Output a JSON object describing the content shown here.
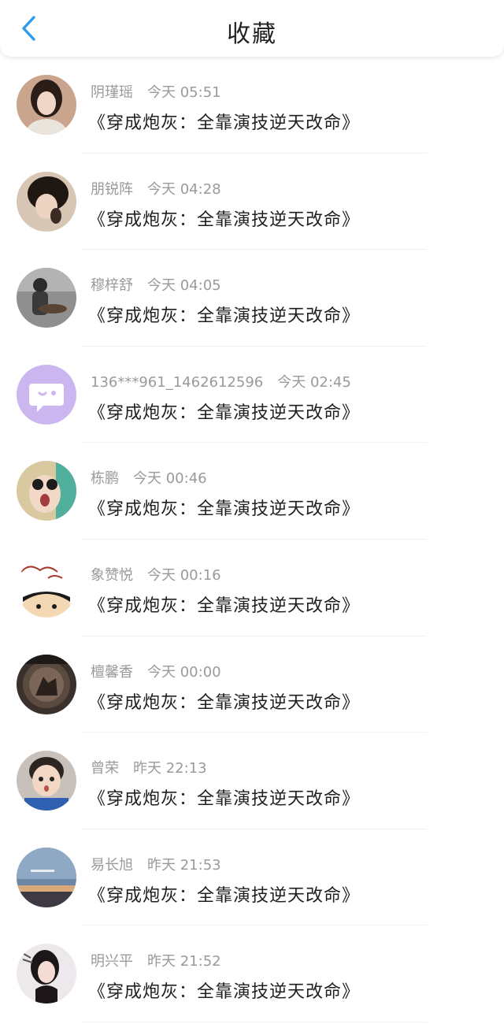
{
  "header": {
    "title": "收藏",
    "back_icon": "chevron-left-icon",
    "accent": "#2f9bea"
  },
  "items": [
    {
      "name": "阴瑾瑶",
      "time": "今天 05:51",
      "book": "《穿成炮灰：全靠演技逆天改命》"
    },
    {
      "name": "朋锐阵",
      "time": "今天 04:28",
      "book": "《穿成炮灰：全靠演技逆天改命》"
    },
    {
      "name": "穆梓舒",
      "time": "今天 04:05",
      "book": "《穿成炮灰：全靠演技逆天改命》"
    },
    {
      "name": "136***961_1462612596",
      "time": "今天 02:45",
      "book": "《穿成炮灰：全靠演技逆天改命》"
    },
    {
      "name": "栋鹏",
      "time": "今天 00:46",
      "book": "《穿成炮灰：全靠演技逆天改命》"
    },
    {
      "name": "象赞悦",
      "time": "今天 00:16",
      "book": "《穿成炮灰：全靠演技逆天改命》"
    },
    {
      "name": "檀馨香",
      "time": "今天 00:00",
      "book": "《穿成炮灰：全靠演技逆天改命》"
    },
    {
      "name": "曾荣",
      "time": "昨天 22:13",
      "book": "《穿成炮灰：全靠演技逆天改命》"
    },
    {
      "name": "易长旭",
      "time": "昨天 21:53",
      "book": "《穿成炮灰：全靠演技逆天改命》"
    },
    {
      "name": "明兴平",
      "time": "昨天 21:52",
      "book": "《穿成炮灰：全靠演技逆天改命》"
    }
  ]
}
